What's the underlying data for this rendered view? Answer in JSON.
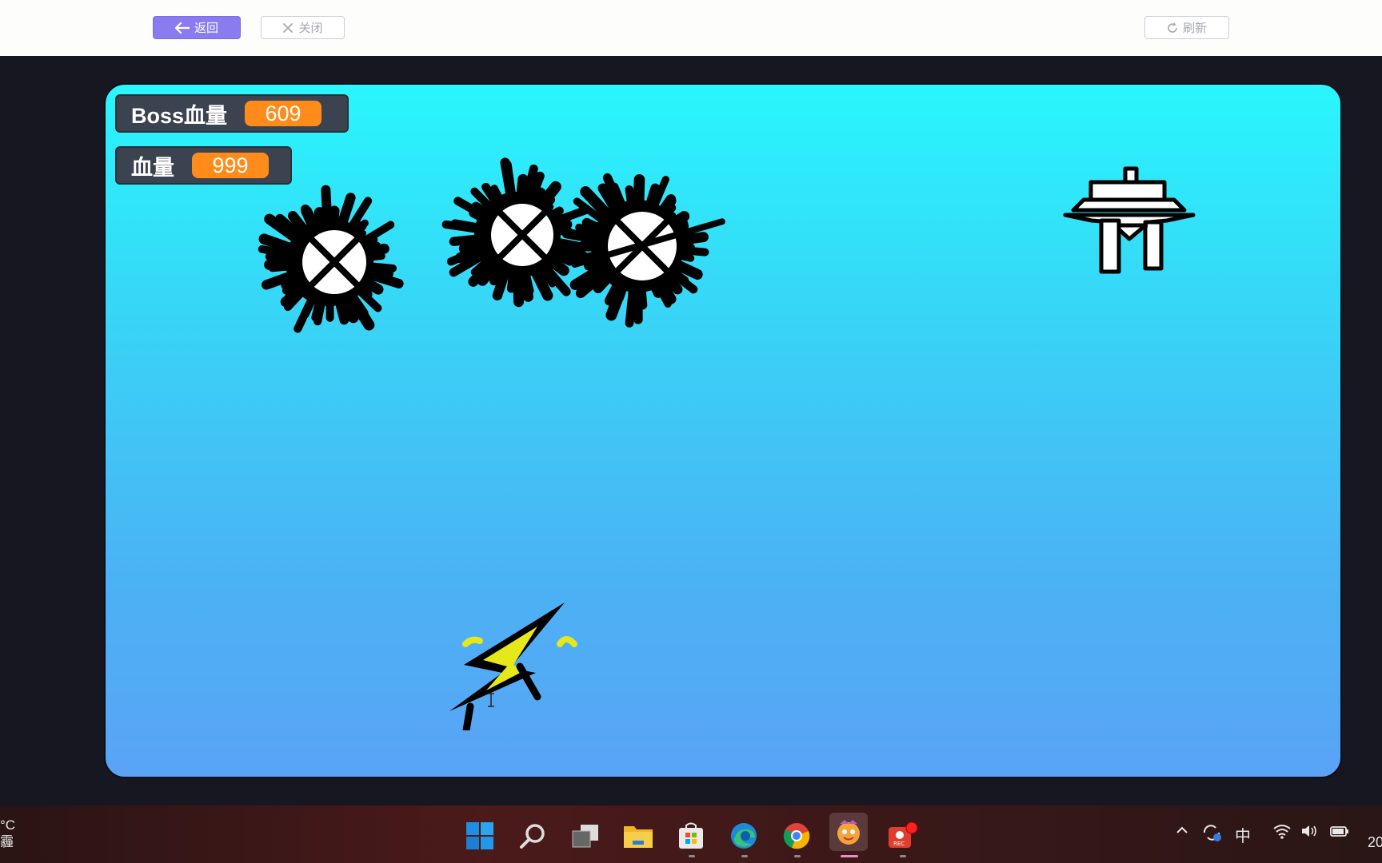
{
  "toolbar": {
    "back_label": "返回",
    "close_label": "关闭",
    "refresh_label": "刷新"
  },
  "monitors": {
    "boss_hp": {
      "label": "Boss血量",
      "value": "609"
    },
    "player_hp": {
      "label": "血量",
      "value": "999"
    }
  },
  "sprites": [
    "spiky-ball-1",
    "spiky-ball-2",
    "spiky-ball-3",
    "boss-ship",
    "lightning-player"
  ],
  "taskbar": {
    "apps": [
      "start-icon",
      "search-icon",
      "task-view-icon",
      "file-explorer-icon",
      "store-icon",
      "edge-icon",
      "chrome-icon",
      "game-app-icon",
      "recorder-icon"
    ],
    "weather_text": "°C",
    "weather_sub": "霾",
    "ime_label": "中",
    "clock_fragment": "20"
  },
  "colors": {
    "accent": "#8a7cf0",
    "monitor_bg": "#3c4350",
    "monitor_value": "#ff8c1a",
    "sky_top": "#29f6fd",
    "sky_bottom": "#5aa3f6"
  }
}
